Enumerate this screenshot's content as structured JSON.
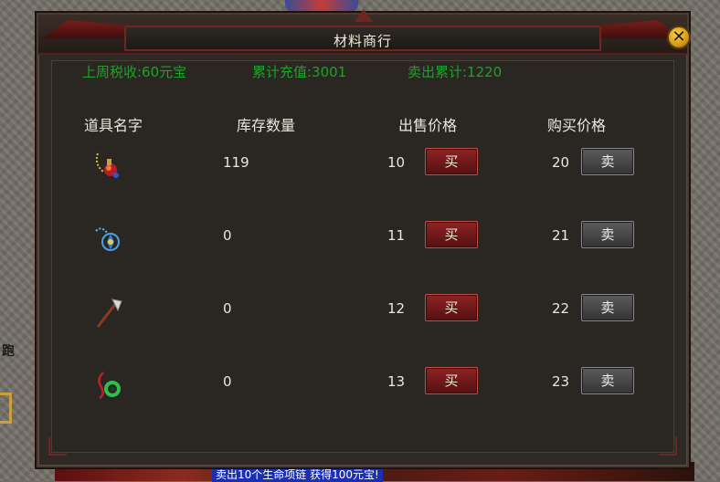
{
  "window": {
    "title": "材料商行",
    "close_label": "✕"
  },
  "stats": {
    "tax": "上周税收:60元宝",
    "recharge": "累计充值:3001",
    "sold": "卖出累计:1220"
  },
  "columns": {
    "name": "道具名字",
    "stock": "库存数量",
    "sell_price": "出售价格",
    "buy_price": "购买价格"
  },
  "rows": [
    {
      "icon": "gem-pendant-icon",
      "stock": "119",
      "sell_price": "10",
      "buy_label": "买",
      "buy_price": "20",
      "sell_label": "卖"
    },
    {
      "icon": "blue-rune-icon",
      "stock": "0",
      "sell_price": "11",
      "buy_label": "买",
      "buy_price": "21",
      "sell_label": "卖"
    },
    {
      "icon": "axe-icon",
      "stock": "0",
      "sell_price": "12",
      "buy_label": "买",
      "buy_price": "22",
      "sell_label": "卖"
    },
    {
      "icon": "jade-ring-icon",
      "stock": "0",
      "sell_price": "13",
      "buy_label": "买",
      "buy_price": "23",
      "sell_label": "卖"
    }
  ],
  "world": {
    "side_char": "跑",
    "chat": "卖出10个生命项链 获得100元宝!"
  },
  "colors": {
    "stat_green": "#21a02b",
    "buy_button": "#8c2424",
    "sell_button": "#4a4a4a",
    "text": "#ece7dc"
  }
}
